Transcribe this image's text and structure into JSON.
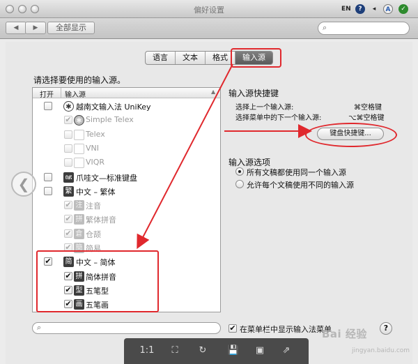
{
  "window": {
    "title": "偏好设置"
  },
  "menubar": {
    "lang": "EN",
    "help_glyph": "?",
    "volume_glyph": "◂",
    "user_glyph": "A",
    "shield_glyph": "✓"
  },
  "toolbar": {
    "back": "◀",
    "forward": "▶",
    "show_all": "全部显示"
  },
  "tabs": [
    {
      "label": "语言"
    },
    {
      "label": "文本"
    },
    {
      "label": "格式"
    },
    {
      "label": "输入源",
      "selected": true
    }
  ],
  "prompt": "请选择要使用的输入源。",
  "list": {
    "header": {
      "enabled": "打开",
      "source": "输入源"
    },
    "rows": [
      {
        "label": "越南文输入法 UniKey",
        "checked": false,
        "dim": false,
        "icon": "✱",
        "indent": 0
      },
      {
        "label": "Simple Telex",
        "checked": true,
        "dim": true,
        "icon": "✱",
        "indent": 1
      },
      {
        "label": "Telex",
        "checked": false,
        "dim": true,
        "icon": "",
        "indent": 1
      },
      {
        "label": "VNI",
        "checked": false,
        "dim": true,
        "icon": "",
        "indent": 1
      },
      {
        "label": "VIQR",
        "checked": false,
        "dim": true,
        "icon": "",
        "indent": 1
      },
      {
        "label": "爪哇文—标准键盘",
        "checked": false,
        "dim": false,
        "icon": "ꦗ",
        "indent": 0
      },
      {
        "label": "中文 – 繁体",
        "checked": false,
        "dim": false,
        "icon": "繁",
        "indent": 0
      },
      {
        "label": "注音",
        "checked": true,
        "dim": true,
        "icon": "注",
        "indent": 1
      },
      {
        "label": "繁体拼音",
        "checked": true,
        "dim": true,
        "icon": "拼",
        "indent": 1
      },
      {
        "label": "仓颉",
        "checked": true,
        "dim": true,
        "icon": "倉",
        "indent": 1
      },
      {
        "label": "简易",
        "checked": true,
        "dim": true,
        "icon": "簡",
        "indent": 1
      },
      {
        "label": "中文 – 简体",
        "checked": true,
        "dim": false,
        "icon": "简",
        "indent": 0
      },
      {
        "label": "简体拼音",
        "checked": true,
        "dim": false,
        "icon": "拼",
        "indent": 1
      },
      {
        "label": "五笔型",
        "checked": true,
        "dim": false,
        "icon": "型",
        "indent": 1
      },
      {
        "label": "五笔画",
        "checked": true,
        "dim": false,
        "icon": "画",
        "indent": 1
      }
    ]
  },
  "shortcuts": {
    "title": "输入源快捷键",
    "prev_label": "选择上一个输入源:",
    "prev_key": "⌘空格键",
    "next_label": "选择菜单中的下一个输入源:",
    "next_key": "⌥⌘空格键",
    "button": "键盘快捷键..."
  },
  "options": {
    "title": "输入源选项",
    "items": [
      {
        "label": "所有文稿都使用同一个输入源",
        "selected": true
      },
      {
        "label": "允许每个文稿使用不同的输入源",
        "selected": false
      }
    ]
  },
  "bottom": {
    "show_menubar_label": "在菜单栏中显示输入法菜单",
    "show_menubar_checked": true,
    "help": "?"
  },
  "viewer": {
    "zoom_label": "1:1",
    "fit": "⛶",
    "rotate": "↻",
    "save": "💾",
    "window": "▣",
    "share": "⇗"
  },
  "watermark": {
    "brand": "Bai 经验",
    "sub": "jingyan.baidu.com"
  },
  "side_arrow": "❮",
  "colors": {
    "annotation_red": "#e0282d"
  }
}
